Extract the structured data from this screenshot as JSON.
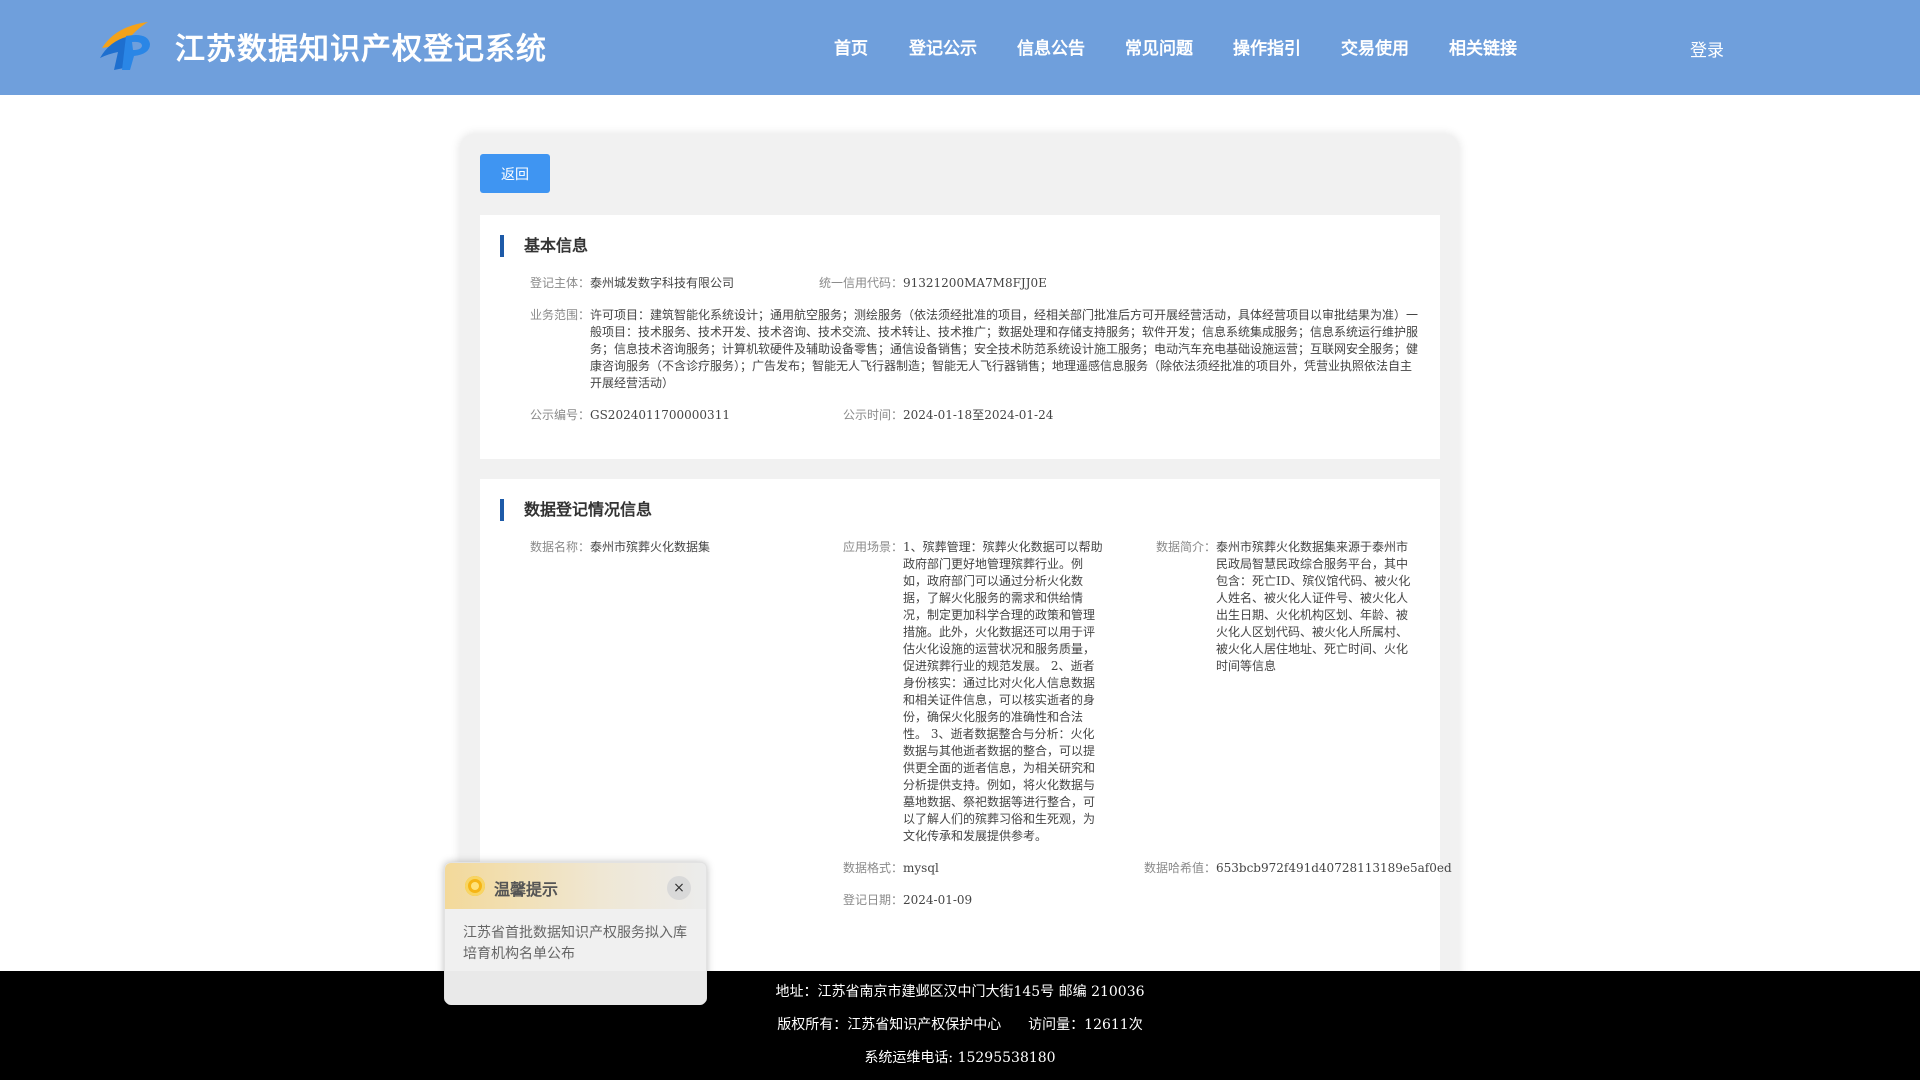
{
  "header": {
    "title": "江苏数据知识产权登记系统",
    "nav": [
      "首页",
      "登记公示",
      "信息公告",
      "常见问题",
      "操作指引",
      "交易使用",
      "相关链接"
    ],
    "login": "登录"
  },
  "back_button": "返回",
  "basic_info": {
    "title": "基本信息",
    "registrant_label": "登记主体：",
    "registrant": "泰州城发数字科技有限公司",
    "credit_code_label": "统一信用代码：",
    "credit_code": "91321200MA7M8FJJ0E",
    "business_scope_label": "业务范围：",
    "business_scope": "许可项目：建筑智能化系统设计；通用航空服务；测绘服务（依法须经批准的项目，经相关部门批准后方可开展经营活动，具体经营项目以审批结果为准）一般项目：技术服务、技术开发、技术咨询、技术交流、技术转让、技术推广；数据处理和存储支持服务；软件开发；信息系统集成服务；信息系统运行维护服务；信息技术咨询服务；计算机软硬件及辅助设备零售；通信设备销售；安全技术防范系统设计施工服务；电动汽车充电基础设施运营；互联网安全服务；健康咨询服务（不含诊疗服务）；广告发布；智能无人飞行器制造；智能无人飞行器销售；地理遥感信息服务（除依法须经批准的项目外，凭营业执照依法自主开展经营活动）",
    "notice_no_label": "公示编号：",
    "notice_no": "GS2024011700000311",
    "notice_time_label": "公示时间：",
    "notice_time": "2024-01-18至2024-01-24"
  },
  "data_info": {
    "title": "数据登记情况信息",
    "name_label": "数据名称：",
    "name": "泰州市殡葬火化数据集",
    "scene_label": "应用场景：",
    "scene": "1、殡葬管理：殡葬火化数据可以帮助政府部门更好地管理殡葬行业。例如，政府部门可以通过分析火化数据，了解火化服务的需求和供给情况，制定更加科学合理的政策和管理措施。此外，火化数据还可以用于评估火化设施的运营状况和服务质量，促进殡葬行业的规范发展。 2、逝者身份核实：通过比对火化人信息数据和相关证件信息，可以核实逝者的身份，确保火化服务的准确性和合法性。 3、逝者数据整合与分析：火化数据与其他逝者数据的整合，可以提供更全面的逝者信息，为相关研究和分析提供支持。例如，将火化数据与墓地数据、祭祀数据等进行整合，可以了解人们的殡葬习俗和生死观，为文化传承和发展提供参考。",
    "intro_label": "数据简介：",
    "intro": "泰州市殡葬火化数据集来源于泰州市民政局智慧民政综合服务平台，其中包含：死亡ID、殡仪馆代码、被火化人姓名、被火化人证件号、被火化人出生日期、火化机构区划、年龄、被火化人区划代码、被火化人所属村、被火化人居住地址、死亡时间、火化时间等信息",
    "format_label": "数据格式：",
    "format": "mysql",
    "hash_label": "数据哈希值：",
    "hash": "653bcb972f491d40728113189e5af0ed",
    "reg_date_label": "登记日期：",
    "reg_date": "2024-01-09"
  },
  "popup": {
    "title": "温馨提示",
    "close": "×",
    "body": "江苏省首批数据知识产权服务拟入库培育机构名单公布"
  },
  "footer": {
    "address": "地址：江苏省南京市建邺区汉中门大街145号 邮编 210036",
    "copyright": "版权所有：江苏省知识产权保护中心",
    "visits": "访问量：12611次",
    "phone": "系统运维电话: 15295538180"
  },
  "colors": {
    "header_bg": "#6f9fdc",
    "button_blue": "#3f95f2",
    "section_accent": "#1d5aa8",
    "footer_bg": "#000000"
  }
}
